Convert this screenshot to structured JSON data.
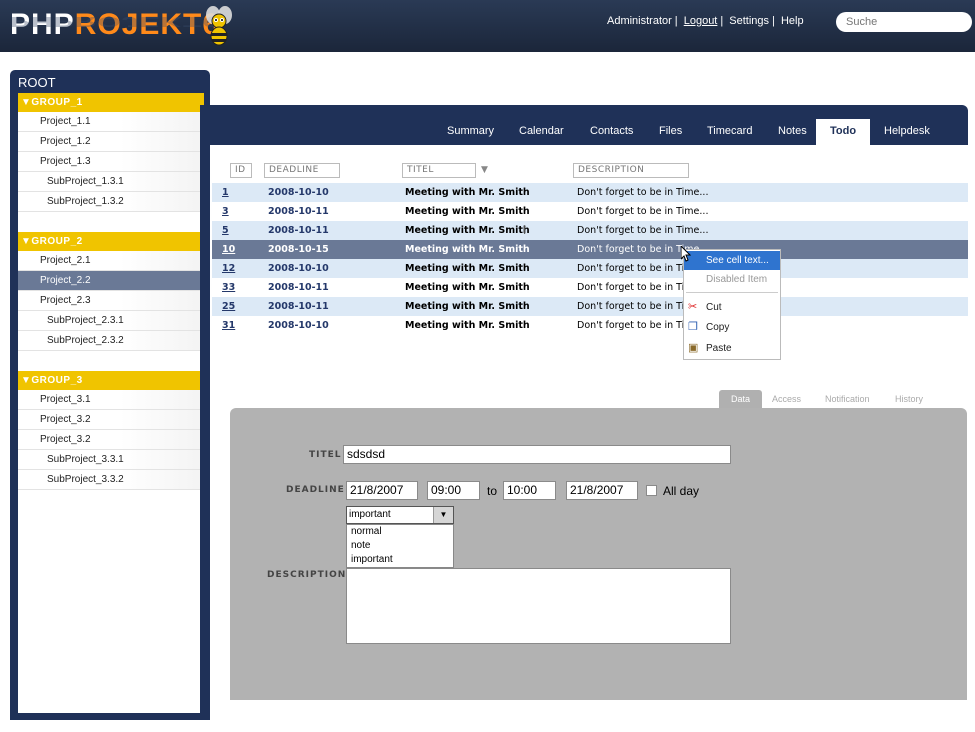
{
  "app": {
    "logo_part1": "PHP",
    "logo_part2": "ROJEKT6"
  },
  "header": {
    "user": "Administrator",
    "links": [
      "Logout",
      "Settings",
      "Help"
    ],
    "search_placeholder": "Suche"
  },
  "sidebar": {
    "title": "ROOT",
    "groups": [
      {
        "label": "▼GROUP_1",
        "items": [
          {
            "label": "Project_1.1",
            "sub": false
          },
          {
            "label": "Project_1.2",
            "sub": false
          },
          {
            "label": "Project_1.3",
            "sub": false
          },
          {
            "label": "SubProject_1.3.1",
            "sub": true
          },
          {
            "label": "SubProject_1.3.2",
            "sub": true
          }
        ]
      },
      {
        "label": "▼GROUP_2",
        "items": [
          {
            "label": "Project_2.1",
            "sub": false
          },
          {
            "label": "Project_2.2",
            "sub": false,
            "selected": true
          },
          {
            "label": "Project_2.3",
            "sub": false
          },
          {
            "label": "SubProject_2.3.1",
            "sub": true
          },
          {
            "label": "SubProject_2.3.2",
            "sub": true
          }
        ]
      },
      {
        "label": "▼GROUP_3",
        "items": [
          {
            "label": "Project_3.1",
            "sub": false
          },
          {
            "label": "Project_3.2",
            "sub": false
          },
          {
            "label": "Project_3.2",
            "sub": false
          },
          {
            "label": "SubProject_3.3.1",
            "sub": true
          },
          {
            "label": "SubProject_3.3.2",
            "sub": true
          }
        ]
      }
    ]
  },
  "tabs": [
    {
      "label": "Summary"
    },
    {
      "label": "Calendar"
    },
    {
      "label": "Contacts"
    },
    {
      "label": "Files"
    },
    {
      "label": "Timecard"
    },
    {
      "label": "Notes"
    },
    {
      "label": "Todo",
      "active": true
    },
    {
      "label": "Helpdesk"
    }
  ],
  "table": {
    "columns": [
      "ID",
      "DEADLINE",
      "TITEL",
      "DESCRIPTION"
    ],
    "sort_indicator": "▼",
    "rows": [
      {
        "id": "1",
        "deadline": "2008-10-10",
        "titel": "Meeting with Mr. Smith",
        "description": "Don't forget to be in Time...",
        "alt": true
      },
      {
        "id": "3",
        "deadline": "2008-10-11",
        "titel": "Meeting with Mr. Smith",
        "description": "Don't forget to be in Time...",
        "alt": false
      },
      {
        "id": "5",
        "deadline": "2008-10-11",
        "titel": "Meeting with Mr. Smith",
        "description": "Don't forget to be in Time...",
        "alt": true
      },
      {
        "id": "10",
        "deadline": "2008-10-15",
        "titel": "Meeting with Mr. Smith",
        "description": "Don't forget to be in Time...",
        "selected": true
      },
      {
        "id": "12",
        "deadline": "2008-10-10",
        "titel": "Meeting with Mr. Smith",
        "description": "Don't forget to be in Ti",
        "alt": true
      },
      {
        "id": "33",
        "deadline": "2008-10-11",
        "titel": "Meeting with Mr. Smith",
        "description": "Don't forget to be in Ti",
        "alt": false
      },
      {
        "id": "25",
        "deadline": "2008-10-11",
        "titel": "Meeting with Mr. Smith",
        "description": "Don't forget to be in Ti",
        "alt": true
      },
      {
        "id": "31",
        "deadline": "2008-10-10",
        "titel": "Meeting with Mr. Smith",
        "description": "Don't forget to be in Ti",
        "alt": false
      }
    ]
  },
  "context_menu": {
    "items": [
      {
        "label": "See cell text...",
        "state": "highlighted"
      },
      {
        "label": "Disabled Item",
        "state": "disabled"
      },
      {
        "label": "Cut",
        "icon": "scissors-icon"
      },
      {
        "label": "Copy",
        "icon": "copy-icon"
      },
      {
        "label": "Paste",
        "icon": "paste-icon"
      }
    ]
  },
  "form_tabs": [
    {
      "label": "Data",
      "active": true
    },
    {
      "label": "Access"
    },
    {
      "label": "Notification"
    },
    {
      "label": "History"
    }
  ],
  "form": {
    "titel_label": "TITEL",
    "titel_value": "sdsdsd",
    "deadline_label": "DEADLINE",
    "date_from": "21/8/2007",
    "time_from": "09:00",
    "to_label": "to",
    "time_to": "10:00",
    "date_to": "21/8/2007",
    "allday_label": "All day",
    "priority_value": "important",
    "priority_options": [
      "normal",
      "note",
      "important"
    ],
    "description_label": "DESCRIPTION"
  }
}
